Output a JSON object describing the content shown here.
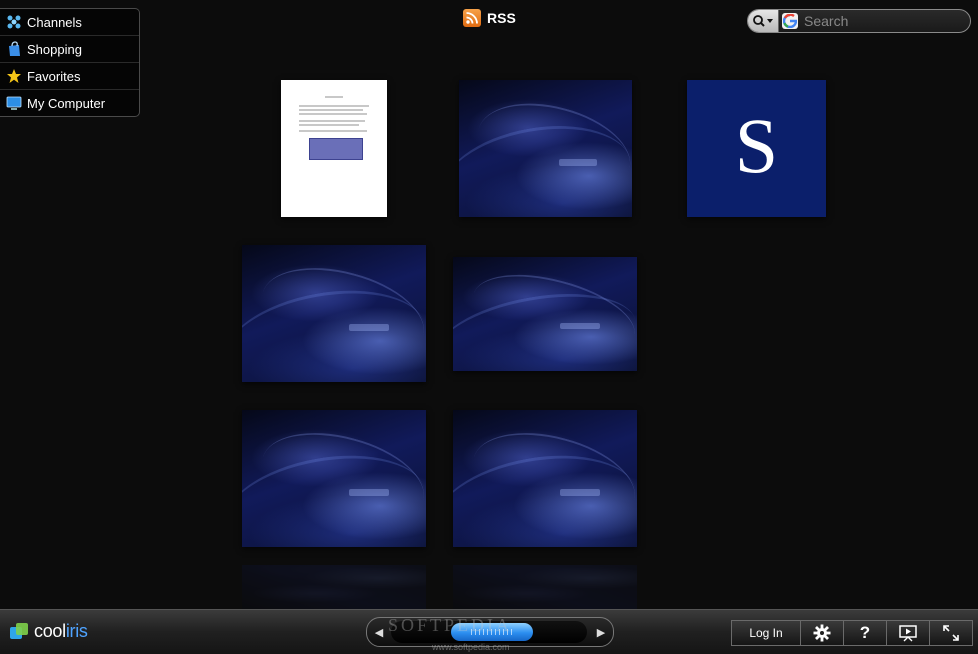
{
  "sidebar": {
    "items": [
      {
        "label": "Channels",
        "icon": "channels-icon"
      },
      {
        "label": "Shopping",
        "icon": "shopping-bag-icon"
      },
      {
        "label": "Favorites",
        "icon": "star-icon"
      },
      {
        "label": "My Computer",
        "icon": "monitor-icon"
      }
    ]
  },
  "header": {
    "feed_label": "RSS",
    "feed_icon": "rss-icon"
  },
  "search": {
    "placeholder": "Search",
    "provider_icon": "google-icon"
  },
  "thumbnails": [
    {
      "kind": "document"
    },
    {
      "kind": "wallpaper"
    },
    {
      "kind": "logo",
      "text": "S"
    },
    {
      "kind": "wallpaper"
    },
    {
      "kind": "wallpaper"
    },
    {
      "kind": "wallpaper"
    },
    {
      "kind": "wallpaper"
    }
  ],
  "bottombar": {
    "brand_prefix": "cool",
    "brand_suffix": "iris",
    "login_label": "Log In",
    "settings_icon": "gear-icon",
    "help_label": "?",
    "slideshow_icon": "slideshow-icon",
    "fullscreen_icon": "fullscreen-icon"
  },
  "watermark": {
    "text": "SOFTPEDIA",
    "url": "www.softpedia.com"
  },
  "colors": {
    "background": "#0c0c0c",
    "accent_blue": "#2b8ef0",
    "rss_orange": "#f08a24",
    "logo_blue": "#0b1f6b"
  }
}
